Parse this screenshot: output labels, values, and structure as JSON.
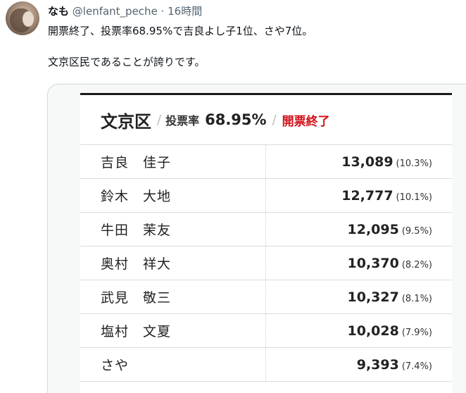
{
  "tweet": {
    "display_name": "なも",
    "handle": "@lenfant_peche",
    "separator": "·",
    "time": "16時間",
    "line1": "開票終了、投票率68.95%で吉良よし子1位、さや7位。",
    "line2": "文京区民であることが誇りです。"
  },
  "card": {
    "ward": "文京区",
    "separator": "/",
    "turnout_label": "投票率",
    "turnout_value": "68.95%",
    "separator2": "/",
    "status": "開票終了",
    "rows": [
      {
        "name": "吉良　佳子",
        "count": "13,089",
        "pct": "(10.3%)"
      },
      {
        "name": "鈴木　大地",
        "count": "12,777",
        "pct": "(10.1%)"
      },
      {
        "name": "牛田　茉友",
        "count": "12,095",
        "pct": "(9.5%)"
      },
      {
        "name": "奥村　祥大",
        "count": "10,370",
        "pct": "(8.2%)"
      },
      {
        "name": "武見　敬三",
        "count": "10,327",
        "pct": "(8.1%)"
      },
      {
        "name": "塩村　文夏",
        "count": "10,028",
        "pct": "(7.9%)"
      },
      {
        "name": "さや",
        "count": "9,393",
        "pct": "(7.4%)"
      }
    ]
  },
  "colors": {
    "status_red": "#d0121b",
    "muted_text": "#536471"
  }
}
